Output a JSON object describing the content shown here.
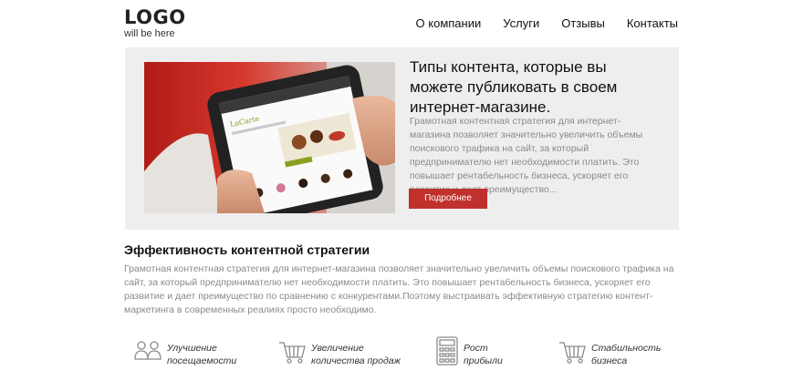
{
  "logo": {
    "main": "LOGO",
    "sub": "will be here"
  },
  "nav": {
    "items": [
      "О компании",
      "Услуги",
      "Отзывы",
      "Контакты"
    ]
  },
  "hero": {
    "title": "Типы контента, которые вы можете публиковать в своем интернет-магазине.",
    "text": "Грамотная контентная стратегия для интернет-магазина позволяет значительно увеличить объемы поискового трафика на сайт, за который предпринимателю нет необходимости платить. Это повышает рентабельность бизнеса, ускоряет его развитие и дает преимущество...",
    "button": "Подробнее",
    "image_caption": "LaCarte"
  },
  "section": {
    "title": "Эффективность контентной стратегии",
    "text": "Грамотная контентная стратегия для интернет-магазина позволяет значительно увеличить объемы поискового трафика на сайт, за который предпринимателю нет необходимости платить. Это повышает рентабельность бизнеса, ускоряет его развитие и дает преимущество по сравнению с конкурентами.Поэтому выстраивать эффективную стратегию контент-маркетинга в современных реалиях просто необходимо."
  },
  "features": [
    {
      "icon": "users-icon",
      "line1": "Улучшение",
      "line2": "посещаемости"
    },
    {
      "icon": "cart-icon",
      "line1": "Увеличение",
      "line2": "количества продаж"
    },
    {
      "icon": "calculator-icon",
      "line1": "Рост",
      "line2": "прибыли"
    },
    {
      "icon": "cart-icon",
      "line1": "Стабильность",
      "line2": "бизнеса"
    }
  ],
  "colors": {
    "accent": "#c0302d",
    "hero_bg": "#eeeeee",
    "muted_text": "#8a8a8a"
  }
}
